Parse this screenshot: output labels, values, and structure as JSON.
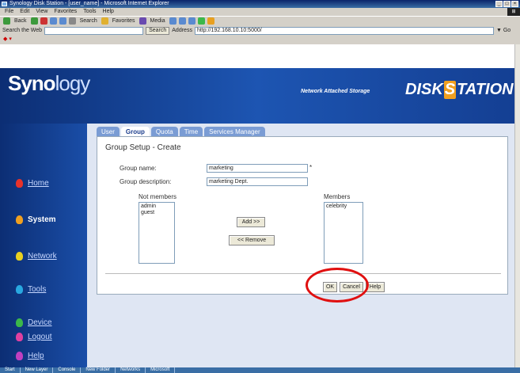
{
  "window": {
    "title": "Synology Disk Station - [user_name] - Microsoft Internet Explorer"
  },
  "menu": [
    "File",
    "Edit",
    "View",
    "Favorites",
    "Tools",
    "Help"
  ],
  "toolbar": {
    "back": "Back",
    "search": "Search",
    "favorites": "Favorites",
    "media": "Media"
  },
  "address": {
    "search_label": "Search the Web",
    "search_button": "Search",
    "address_label": "Address",
    "url": "http://192.168.10.10:5000/"
  },
  "banner": {
    "brand_bold": "Syno",
    "brand_light": "logy",
    "tagline": "Network Attached Storage",
    "ds_left": "DISK",
    "ds_s": "S",
    "ds_right": "TATION"
  },
  "nav": [
    {
      "label": "Home",
      "color": "#e8322a",
      "active": false
    },
    {
      "label": "System",
      "color": "#f0a020",
      "active": true
    },
    {
      "label": "Network",
      "color": "#e8d020",
      "active": false
    },
    {
      "label": "Tools",
      "color": "#29a8e0",
      "active": false
    },
    {
      "label": "Device",
      "color": "#3cb84a",
      "active": false
    },
    {
      "label": "Help",
      "color": "#c040c0",
      "active": false
    },
    {
      "label": "Logout",
      "color": "#e040a0",
      "active": false
    }
  ],
  "tabs": [
    "User",
    "Group",
    "Quota",
    "Time",
    "Services Manager"
  ],
  "active_tab": "Group",
  "form": {
    "title": "Group Setup - Create",
    "name_label": "Group name:",
    "name_value": "marketing",
    "desc_label": "Group description:",
    "desc_value": "marketing Dept.",
    "not_members_label": "Not members",
    "not_members": [
      "admin",
      "guest"
    ],
    "members_label": "Members",
    "members": [
      "celebrity"
    ],
    "add_button": "Add >>",
    "remove_button": "<< Remove",
    "ok_button": "OK",
    "cancel_button": "Cancel",
    "help_button": "Help"
  },
  "taskbar": [
    "Start",
    "New Layer",
    "Console",
    "New Folder",
    "Networks",
    "Microsoft"
  ]
}
